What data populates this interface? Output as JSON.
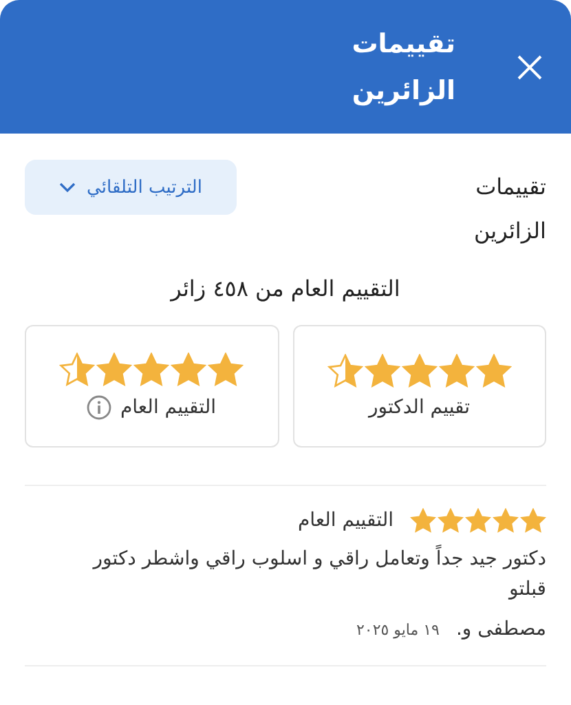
{
  "header": {
    "title": "تقييمات الزائرين"
  },
  "section": {
    "title": "تقييمات الزائرين",
    "sort_button": "الترتيب التلقائي"
  },
  "summary": {
    "title": "التقييم العام من ٤٥٨ زائر"
  },
  "cards": [
    {
      "label": "تقييم الدكتور",
      "stars": 4.5,
      "info": false
    },
    {
      "label": "التقييم العام",
      "stars": 4.5,
      "info": true
    }
  ],
  "reviews": [
    {
      "label": "التقييم العام",
      "stars": 5,
      "text": "دكتور جيد جداً وتعامل راقي و اسلوب راقي واشطر دكتور قبلتو",
      "author": "مصطفى و.",
      "date": "١٩ مايو ٢٠٢٥"
    }
  ]
}
